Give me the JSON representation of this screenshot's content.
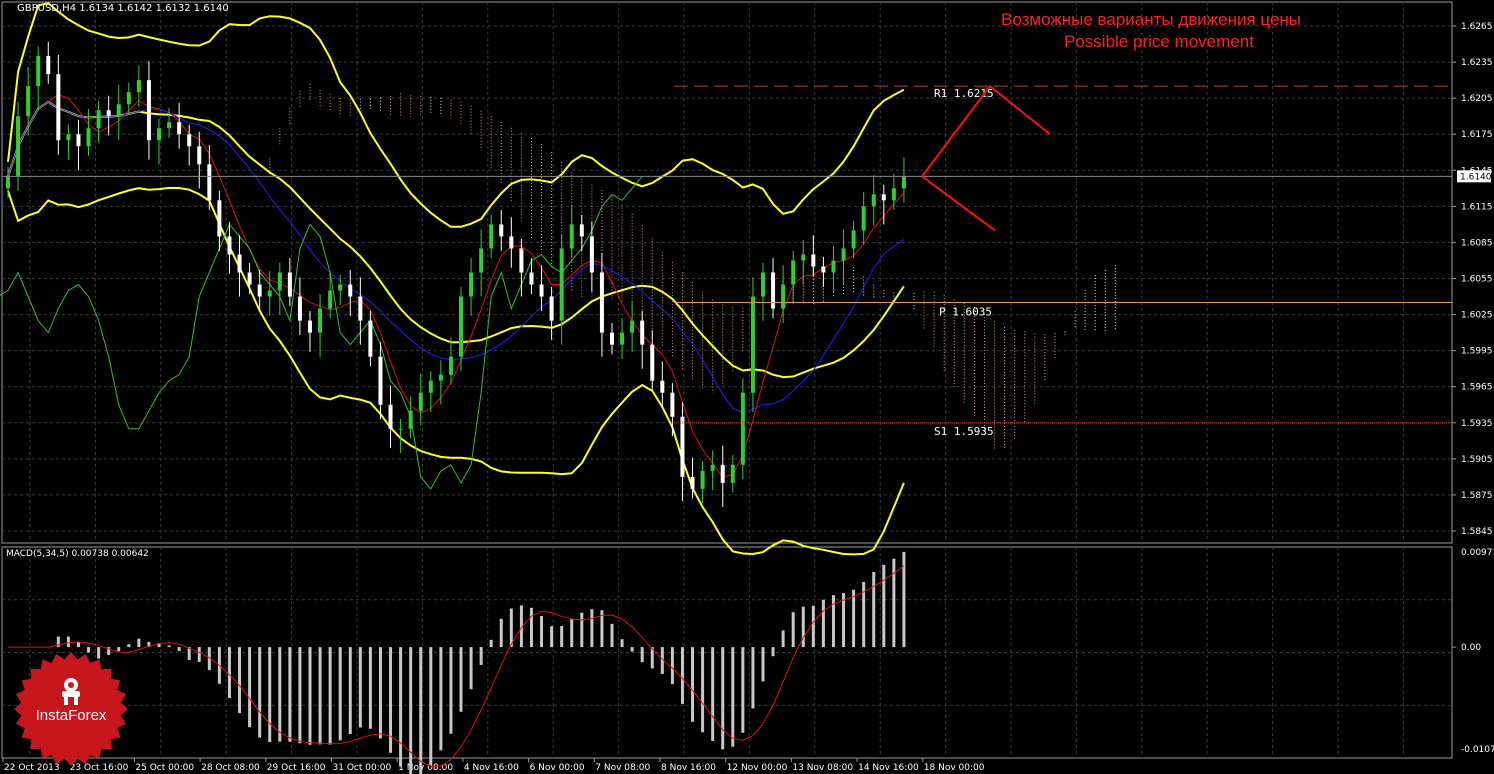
{
  "header": {
    "symbol_info": "GBPUSD,H4  1.6134 1.6142 1.6132 1.6140",
    "title_ru": "Возможные варианты движения цены",
    "title_en": "Possible price movement"
  },
  "price_axis": {
    "ticks": [
      "1.6265",
      "1.6235",
      "1.6205",
      "1.6175",
      "1.6145",
      "1.6115",
      "1.6085",
      "1.6055",
      "1.6025",
      "1.5995",
      "1.5965",
      "1.5935",
      "1.5905",
      "1.5875",
      "1.5845"
    ],
    "current_price": "1.6140"
  },
  "levels": {
    "r1_label": "R1  1.6215",
    "p_label": "P  1.6035",
    "s1_label": "S1  1.5935",
    "r1": 1.6215,
    "p": 1.6035,
    "s1": 1.5935,
    "r1_color": "#c0402a",
    "p_color": "#e0a040",
    "s1_color": "#c0402a"
  },
  "macd": {
    "label": "MACD(5,34,5) 0.00738 0.00642",
    "axis_ticks": [
      "0.00971",
      "0.00",
      "-0.01076"
    ]
  },
  "time_axis": [
    "22 Oct 2013",
    "23 Oct 16:00",
    "25 Oct 00:00",
    "28 Oct 08:00",
    "29 Oct 16:00",
    "31 Oct 00:00",
    "1 Nov 08:00",
    "4 Nov 16:00",
    "6 Nov 00:00",
    "7 Nov 08:00",
    "8 Nov 16:00",
    "12 Nov 00:00",
    "13 Nov 08:00",
    "14 Nov 16:00",
    "18 Nov 00:00"
  ],
  "logo": {
    "text": "InstaForex",
    "color": "#c8161d"
  },
  "colors": {
    "background": "#000000",
    "grid": "#3a3a3a",
    "bull_candle": "#32cd32",
    "bear_candle": "#ffffff",
    "bollinger": "#ffff20",
    "tenkan": "#e01010",
    "kijun": "#2020ff",
    "chikou": "#30c030",
    "macd_hist": "#c8c8c8",
    "macd_signal": "#e01010",
    "forecast": "#ff1010"
  },
  "chart_data": {
    "type": "candlestick",
    "symbol": "GBPUSD",
    "timeframe": "H4",
    "ylim": [
      1.5835,
      1.6285
    ],
    "candles_close": [
      1.614,
      1.619,
      1.6215,
      1.624,
      1.6225,
      1.617,
      1.6175,
      1.6165,
      1.618,
      1.6195,
      1.619,
      1.62,
      1.621,
      1.622,
      1.617,
      1.618,
      1.6185,
      1.6175,
      1.6165,
      1.615,
      1.612,
      1.609,
      1.6075,
      1.606,
      1.605,
      1.604,
      1.6045,
      1.606,
      1.604,
      1.602,
      1.601,
      1.603,
      1.6045,
      1.605,
      1.604,
      1.602,
      1.599,
      1.595,
      1.593,
      1.593,
      1.5945,
      1.596,
      1.597,
      1.5975,
      1.599,
      1.604,
      1.606,
      1.608,
      1.61,
      1.609,
      1.608,
      1.606,
      1.605,
      1.604,
      1.602,
      1.608,
      1.61,
      1.609,
      1.606,
      1.601,
      1.6,
      1.601,
      1.602,
      1.6,
      1.597,
      1.596,
      1.594,
      1.589,
      1.588,
      1.5895,
      1.59,
      1.5885,
      1.59,
      1.596,
      1.604,
      1.606,
      1.603,
      1.605,
      1.607,
      1.6075,
      1.6065,
      1.606,
      1.607,
      1.608,
      1.6095,
      1.6115,
      1.6125,
      1.612,
      1.613,
      1.614
    ],
    "forecast_paths": [
      {
        "name": "up",
        "from": 1.614,
        "to": 1.6215
      },
      {
        "name": "down",
        "from": 1.614,
        "to": 1.6095
      }
    ]
  }
}
